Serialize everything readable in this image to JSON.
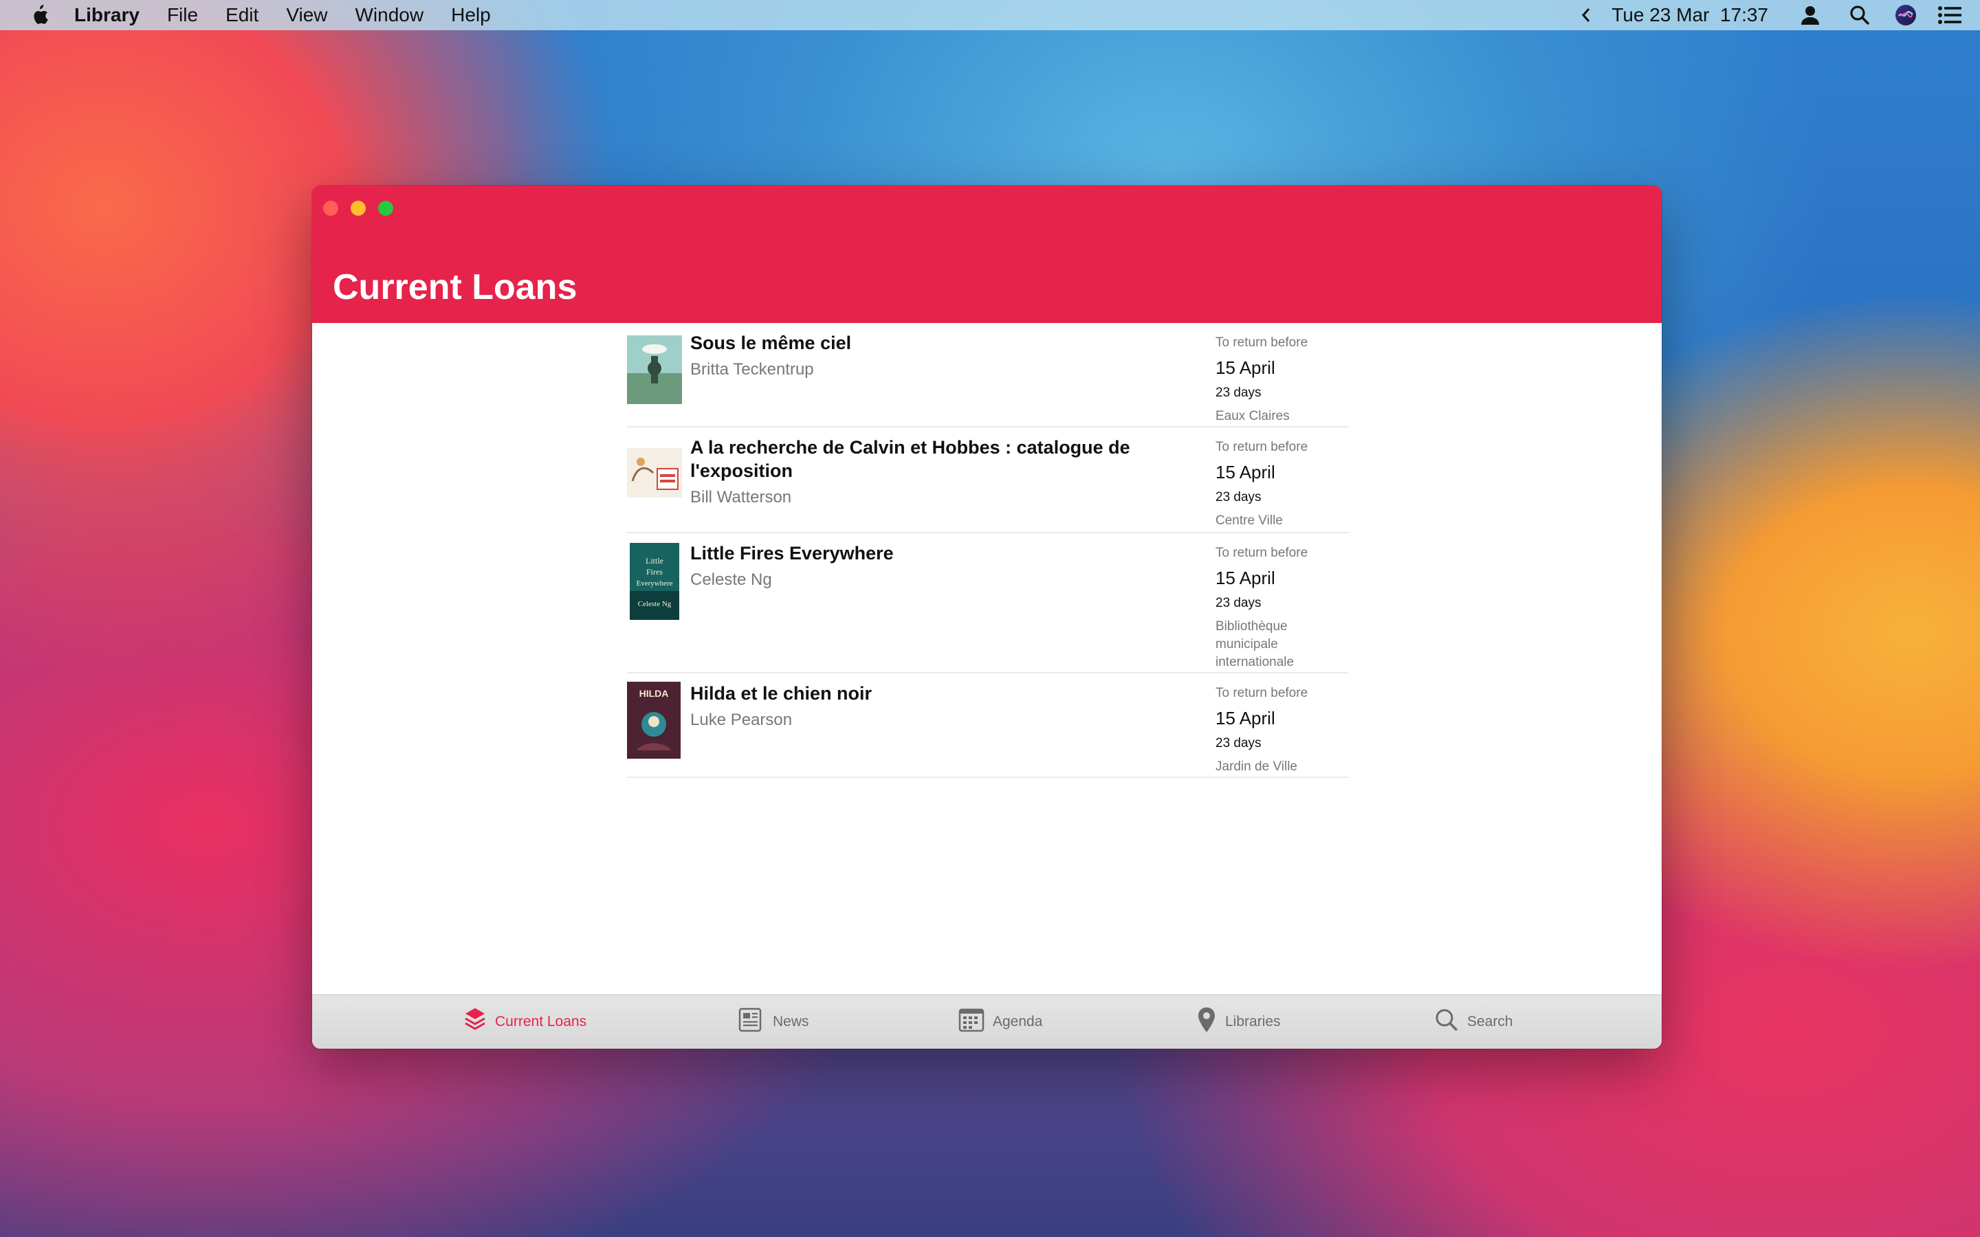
{
  "menubar": {
    "app_name": "Library",
    "items": [
      "File",
      "Edit",
      "View",
      "Window",
      "Help"
    ],
    "clock": "Tue 23 Mar  17:37"
  },
  "window": {
    "title": "Current Loans"
  },
  "loans": [
    {
      "title": "Sous le même ciel",
      "author": "Britta Teckentrup",
      "due_label": "To return before",
      "due_date": "15 April",
      "days": "23 days",
      "library": "Eaux Claires",
      "cover_colors": [
        "#8cc3c0",
        "#3f6a4f"
      ]
    },
    {
      "title": "A la recherche de Calvin et Hobbes : catalogue de l'exposition",
      "author": "Bill Watterson",
      "due_label": "To return before",
      "due_date": "15 April",
      "days": "23 days",
      "library": "Centre Ville",
      "cover_colors": [
        "#f3ece2",
        "#d6463d"
      ]
    },
    {
      "title": "Little Fires Everywhere",
      "author": "Celeste Ng",
      "due_label": "To return before",
      "due_date": "15 April",
      "days": "23 days",
      "library": "Bibliothèque municipale internationale",
      "cover_colors": [
        "#1c6b66",
        "#0b3a3a"
      ]
    },
    {
      "title": "Hilda et le chien noir",
      "author": "Luke Pearson",
      "due_label": "To return before",
      "due_date": "15 April",
      "days": "23 days",
      "library": "Jardin de Ville",
      "cover_colors": [
        "#5a2636",
        "#2a7f8a"
      ]
    }
  ],
  "tabs": [
    {
      "label": "Current Loans",
      "icon": "stack-icon",
      "active": true
    },
    {
      "label": "News",
      "icon": "newspaper-icon",
      "active": false
    },
    {
      "label": "Agenda",
      "icon": "calendar-icon",
      "active": false
    },
    {
      "label": "Libraries",
      "icon": "map-pin-icon",
      "active": false
    },
    {
      "label": "Search",
      "icon": "search-icon",
      "active": false
    }
  ],
  "colors": {
    "accent": "#e5234b",
    "tab_inactive": "#6b6b6b"
  }
}
